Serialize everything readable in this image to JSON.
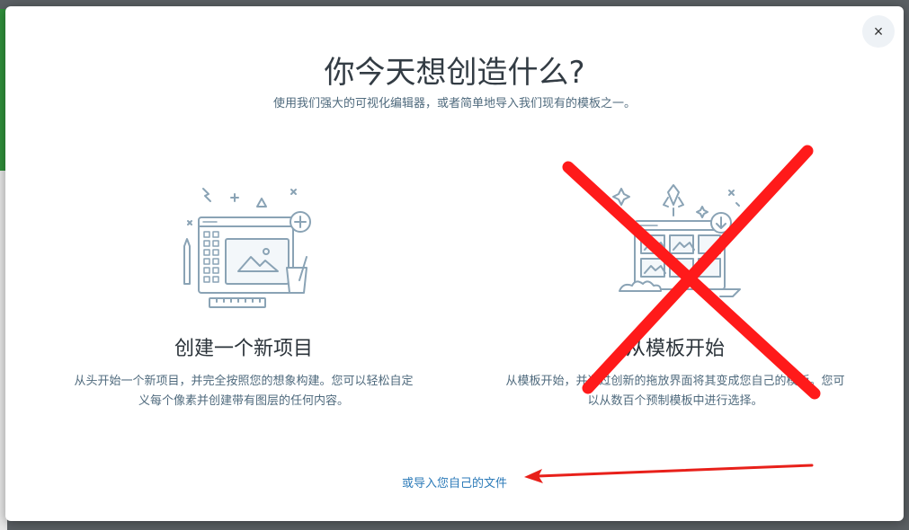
{
  "dialog": {
    "title": "你今天想创造什么?",
    "subtitle": "使用我们强大的可视化编辑器，或者简单地导入我们现有的模板之一。",
    "close_label": "×"
  },
  "options": [
    {
      "title": "创建一个新项目",
      "description": "从头开始一个新项目，并完全按照您的想象构建。您可以轻松自定义每个像素并创建带有图层的任何内容。",
      "icon": "editor-canvas-icon"
    },
    {
      "title": "从模板开始",
      "description": "从模板开始，并通过创新的拖放界面将其变成您自己的模板。您可以从数百个预制模板中进行选择。",
      "icon": "template-rocket-icon"
    }
  ],
  "import_link": "或导入您自己的文件",
  "annotations": {
    "cross_color": "#ff1a1a",
    "arrow_color": "#e8201a"
  }
}
